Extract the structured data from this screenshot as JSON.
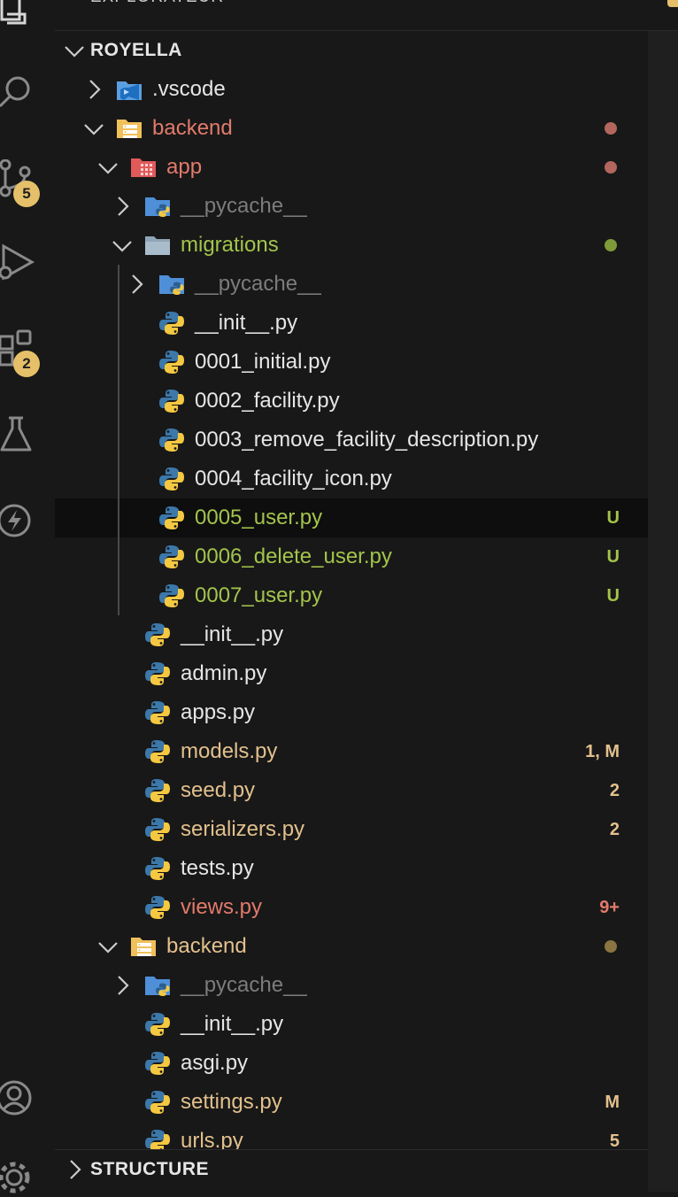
{
  "colors": {
    "default": "#e6e6e6",
    "modified": "#e2c08d",
    "untracked": "#a3c44b",
    "error": "#e27a6b",
    "ignored": "#7c7c7c",
    "badge": "#e5c069"
  },
  "activity_bar": {
    "icons": [
      "explorer-icon",
      "search-icon",
      "source-control-icon",
      "run-debug-icon",
      "extensions-icon",
      "testing-icon",
      "lightning-icon",
      "account-icon",
      "gear-icon"
    ],
    "source_control_badge": "5",
    "extensions_badge": "2"
  },
  "explorer": {
    "title": "EXPLORATEUR",
    "more": "···",
    "project": "ROYELLA",
    "outline": "STRUCTURE",
    "items": [
      {
        "label": ".vscode",
        "kind": "folder",
        "icon": "vscode-folder-icon",
        "state": "default",
        "expanded": false,
        "status": ""
      },
      {
        "label": "backend",
        "kind": "folder",
        "icon": "backend-folder-icon",
        "state": "error",
        "expanded": true,
        "status": "dot"
      },
      {
        "label": "app",
        "kind": "folder",
        "icon": "app-folder-icon",
        "state": "error",
        "expanded": true,
        "status": "dot"
      },
      {
        "label": "__pycache__",
        "kind": "folder",
        "icon": "python-folder-icon",
        "state": "ignored",
        "expanded": false,
        "status": ""
      },
      {
        "label": "migrations",
        "kind": "folder",
        "icon": "migrations-folder-icon",
        "state": "untracked",
        "expanded": true,
        "status": "dot"
      },
      {
        "label": "__pycache__",
        "kind": "folder",
        "icon": "python-folder-icon",
        "state": "ignored",
        "expanded": false,
        "status": ""
      },
      {
        "label": "__init__.py",
        "kind": "file",
        "icon": "python-icon",
        "state": "default",
        "status": ""
      },
      {
        "label": "0001_initial.py",
        "kind": "file",
        "icon": "python-icon",
        "state": "default",
        "status": ""
      },
      {
        "label": "0002_facility.py",
        "kind": "file",
        "icon": "python-icon",
        "state": "default",
        "status": ""
      },
      {
        "label": "0003_remove_facility_description.py",
        "kind": "file",
        "icon": "python-icon",
        "state": "default",
        "status": ""
      },
      {
        "label": "0004_facility_icon.py",
        "kind": "file",
        "icon": "python-icon",
        "state": "default",
        "status": ""
      },
      {
        "label": "0005_user.py",
        "kind": "file",
        "icon": "python-icon",
        "state": "untracked",
        "status": "U",
        "selected": true
      },
      {
        "label": "0006_delete_user.py",
        "kind": "file",
        "icon": "python-icon",
        "state": "untracked",
        "status": "U"
      },
      {
        "label": "0007_user.py",
        "kind": "file",
        "icon": "python-icon",
        "state": "untracked",
        "status": "U"
      },
      {
        "label": "__init__.py",
        "kind": "file",
        "icon": "python-icon",
        "state": "default",
        "status": ""
      },
      {
        "label": "admin.py",
        "kind": "file",
        "icon": "python-icon",
        "state": "default",
        "status": ""
      },
      {
        "label": "apps.py",
        "kind": "file",
        "icon": "python-icon",
        "state": "default",
        "status": ""
      },
      {
        "label": "models.py",
        "kind": "file",
        "icon": "python-icon",
        "state": "modified",
        "status": "1, M"
      },
      {
        "label": "seed.py",
        "kind": "file",
        "icon": "python-icon",
        "state": "modified",
        "status": "2"
      },
      {
        "label": "serializers.py",
        "kind": "file",
        "icon": "python-icon",
        "state": "modified",
        "status": "2"
      },
      {
        "label": "tests.py",
        "kind": "file",
        "icon": "python-icon",
        "state": "default",
        "status": ""
      },
      {
        "label": "views.py",
        "kind": "file",
        "icon": "python-icon",
        "state": "error",
        "status": "9+"
      },
      {
        "label": "backend",
        "kind": "folder",
        "icon": "backend-folder-icon",
        "state": "modified",
        "expanded": true,
        "status": "dot"
      },
      {
        "label": "__pycache__",
        "kind": "folder",
        "icon": "python-folder-icon",
        "state": "ignored",
        "expanded": false,
        "status": ""
      },
      {
        "label": "__init__.py",
        "kind": "file",
        "icon": "python-icon",
        "state": "default",
        "status": ""
      },
      {
        "label": "asgi.py",
        "kind": "file",
        "icon": "python-icon",
        "state": "default",
        "status": ""
      },
      {
        "label": "settings.py",
        "kind": "file",
        "icon": "python-icon",
        "state": "modified",
        "status": "M"
      },
      {
        "label": "urls.py",
        "kind": "file",
        "icon": "python-icon",
        "state": "modified",
        "status": "5"
      }
    ]
  }
}
